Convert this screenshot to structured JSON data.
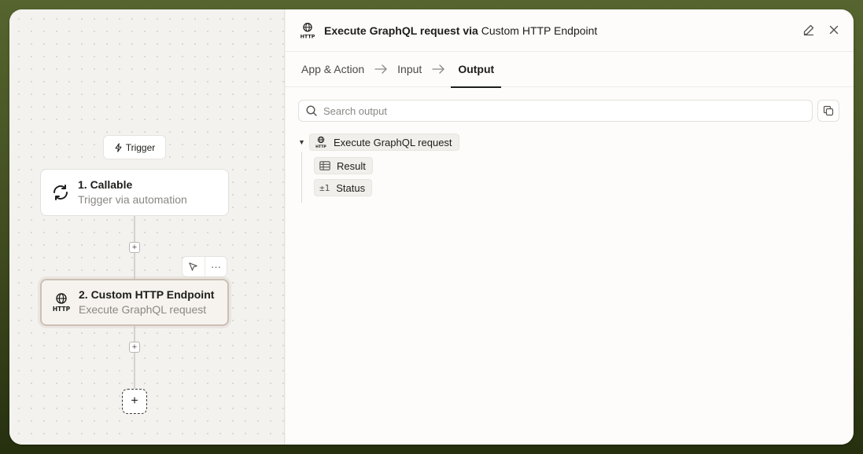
{
  "canvas": {
    "trigger_label": "Trigger",
    "nodes": [
      {
        "title": "1. Callable",
        "subtitle": "Trigger via automation"
      },
      {
        "title": "2. Custom HTTP Endpoint",
        "subtitle": "Execute GraphQL request"
      }
    ],
    "add_symbol": "+",
    "more_symbol": "···"
  },
  "panel": {
    "title_action": "Execute GraphQL request via",
    "title_app": "Custom HTTP Endpoint",
    "tabs": [
      {
        "label": "App & Action"
      },
      {
        "label": "Input"
      },
      {
        "label": "Output"
      }
    ],
    "search": {
      "placeholder": "Search output",
      "value": ""
    },
    "tree": {
      "root_label": "Execute GraphQL request",
      "children": [
        {
          "label": "Result",
          "icon": "table-icon"
        },
        {
          "label": "Status",
          "icon": "number-type-icon",
          "glyph": "±1"
        }
      ]
    }
  }
}
